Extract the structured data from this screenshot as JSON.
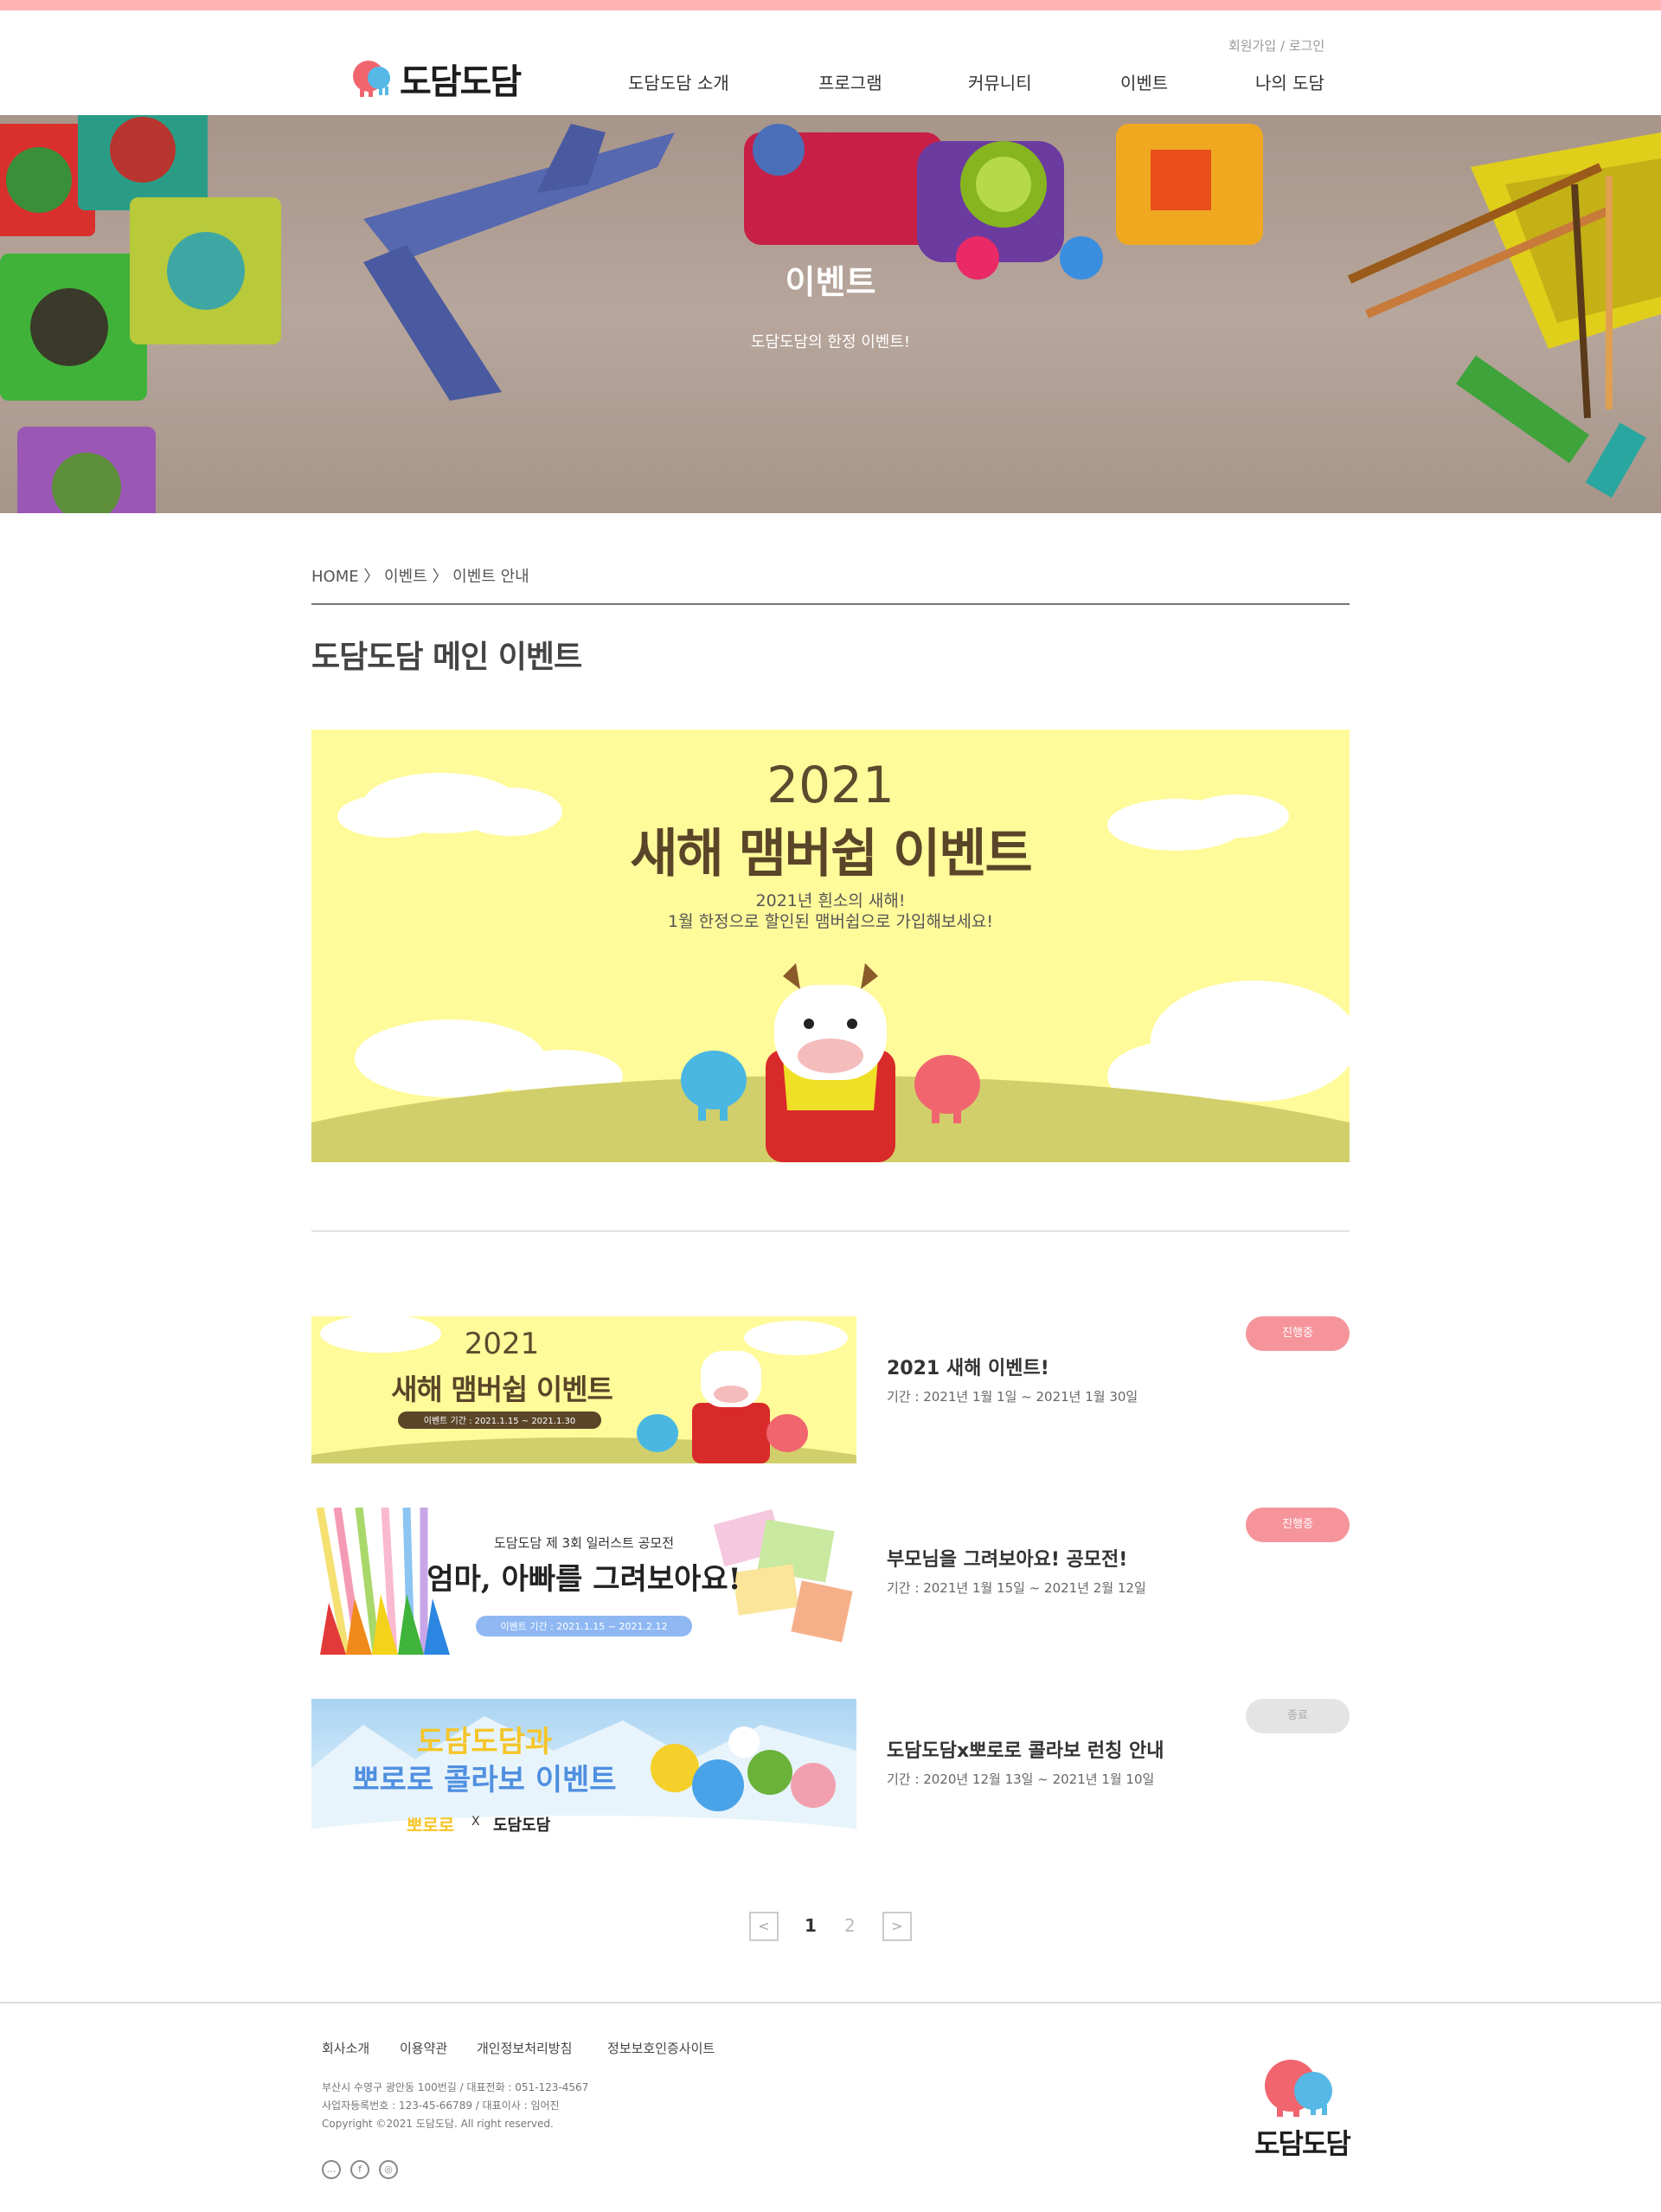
{
  "header": {
    "logo_text": "도담도담",
    "util": "회원가입 / 로그인",
    "nav": [
      "도담도담 소개",
      "프로그램",
      "커뮤니티",
      "이벤트",
      "나의 도담"
    ]
  },
  "hero": {
    "title": "이벤트",
    "subtitle": "도담도담의 한정 이벤트!"
  },
  "breadcrumb": "HOME 〉 이벤트 〉 이벤트 안내",
  "section_title": "도담도담 메인 이벤트",
  "main_banner": {
    "year": "2021",
    "title": "새해 맴버쉽 이벤트",
    "desc1": "2021년 흰소의 새해!",
    "desc2": "1월 한정으로 할인된 맴버쉽으로 가입해보세요!"
  },
  "events": [
    {
      "thumb_year": "2021",
      "thumb_title": "새해 맴버쉽 이벤트",
      "thumb_period": "이벤트 기간 : 2021.1.15 ~ 2021.1.30",
      "title": "2021 새해 이벤트!",
      "period": "기간 : 2021년 1월 1일 ~ 2021년 1월 30일",
      "status": "진행중"
    },
    {
      "thumb_caption": "도담도담 제 3회 일러스트 공모전",
      "thumb_title": "엄마, 아빠를 그려보아요!",
      "thumb_period": "이벤트 기간 : 2021.1.15 ~ 2021.2.12",
      "title": "부모님을 그려보아요! 공모전!",
      "period": "기간 : 2021년 1월 15일 ~ 2021년 2월 12일",
      "status": "진행중"
    },
    {
      "thumb_title1": "도담도담과",
      "thumb_title2": "뽀로로 콜라보 이벤트",
      "thumb_logo1": "뽀로로",
      "thumb_x": "X",
      "thumb_logo2": "도담도담",
      "title": "도담도담x뽀로로 콜라보 런칭 안내",
      "period": "기간 : 2020년 12월 13일 ~ 2021년 1월 10일",
      "status": "종료"
    }
  ],
  "pagination": {
    "prev": "<",
    "pages": [
      "1",
      "2"
    ],
    "next": ">"
  },
  "footer": {
    "links": [
      "회사소개",
      "이용약관",
      "개인정보처리방침",
      "정보보호인증사이트"
    ],
    "address": "부산시 수영구 광안동 100번길 / 대표전화 : 051-123-4567",
    "biz": "사업자등록번호 : 123-45-66789 / 대표이사 : 임어진",
    "copyright": "Copyright ©2021 도담도담. All right reserved.",
    "logo_text": "도담도담",
    "sns": [
      "talk-icon",
      "facebook-icon",
      "instagram-icon"
    ]
  },
  "colors": {
    "accent": "#ffb3b3",
    "badge_active": "#f5959b",
    "badge_done": "#e4e4e4",
    "banner_yellow": "#fffa9a"
  }
}
